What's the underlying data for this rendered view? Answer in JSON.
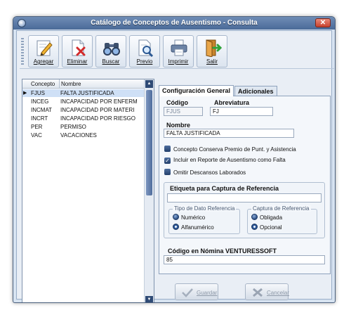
{
  "window": {
    "title": "Catálogo de Conceptos de Ausentismo - Consulta",
    "close_label": "✕"
  },
  "toolbar": {
    "buttons": [
      {
        "label": "Agregar",
        "icon": "pencil-icon"
      },
      {
        "label": "Eliminar",
        "icon": "delete-document-icon"
      },
      {
        "label": "Buscar",
        "icon": "binoculars-icon"
      },
      {
        "label": "Previo",
        "icon": "preview-icon"
      },
      {
        "label": "Imprimir",
        "icon": "printer-icon"
      },
      {
        "label": "Salir",
        "icon": "exit-door-icon"
      }
    ]
  },
  "list": {
    "columns": [
      "Concepto",
      "Nombre"
    ],
    "rows": [
      {
        "concepto": "FJUS",
        "nombre": "FALTA JUSTIFICADA",
        "selected": true
      },
      {
        "concepto": "INCEG",
        "nombre": "INCAPACIDAD POR ENFERM"
      },
      {
        "concepto": "INCMAT",
        "nombre": "INCAPACIDAD POR MATERI"
      },
      {
        "concepto": "INCRT",
        "nombre": "INCAPACIDAD POR RIESGO"
      },
      {
        "concepto": "PER",
        "nombre": "PERMISO"
      },
      {
        "concepto": "VAC",
        "nombre": "VACACIONES"
      }
    ],
    "selected_marker": "▶"
  },
  "tabs": [
    {
      "label": "Configuración General",
      "active": true
    },
    {
      "label": "Adicionales",
      "active": false
    }
  ],
  "form": {
    "codigo_label": "Código",
    "codigo_value": "FJUS",
    "abreviatura_label": "Abreviatura",
    "abreviatura_value": "FJ",
    "nombre_label": "Nombre",
    "nombre_value": "FALTA JUSTIFICADA",
    "checkboxes": [
      {
        "label": "Concepto Conserva Premio de Punt. y Asistencia",
        "checked": false
      },
      {
        "label": "Incluir en Reporte de Ausentismo como Falta",
        "checked": true
      },
      {
        "label": "Omitir Descansos Laborados",
        "checked": false
      }
    ],
    "etiqueta_label": "Etiqueta para Captura de Referencia",
    "etiqueta_value": "",
    "tipo_dato_legend": "Tipo de Dato Referencia",
    "tipo_dato_options": [
      {
        "label": "Numérico",
        "selected": false
      },
      {
        "label": "Alfanumérico",
        "selected": true
      }
    ],
    "captura_legend": "Captura de Referencia",
    "captura_options": [
      {
        "label": "Obligada",
        "selected": false
      },
      {
        "label": "Opcional",
        "selected": true
      }
    ],
    "nomina_label": "Código en Nómina VENTURESSOFT",
    "nomina_value": "85"
  },
  "actions": {
    "guardar_label": "Guardar",
    "cancelar_label": "Cancelar"
  },
  "colors": {
    "titlebar": "#5a7aa8",
    "selection": "#cfe0f6",
    "panel": "#f4f7fb",
    "checkbox": "#2b4c80"
  }
}
